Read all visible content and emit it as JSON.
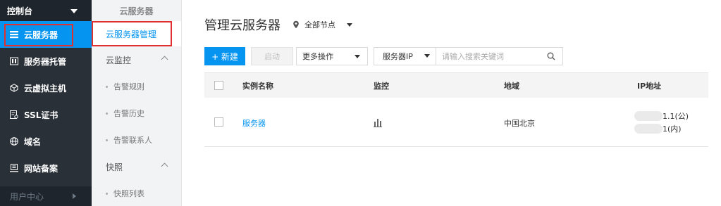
{
  "sidebar": {
    "header": "控制台",
    "items": [
      {
        "label": "云服务器",
        "icon": "server-list-icon"
      },
      {
        "label": "服务器托管",
        "icon": "hosting-icon"
      },
      {
        "label": "云虚拟主机",
        "icon": "cube-icon"
      },
      {
        "label": "SSL证书",
        "icon": "certificate-icon"
      },
      {
        "label": "域名",
        "icon": "globe-icon"
      },
      {
        "label": "网站备案",
        "icon": "record-icon"
      }
    ],
    "bottom": "用户中心"
  },
  "subnav": {
    "title": "云服务器",
    "active_link": "云服务器管理",
    "groups": [
      {
        "label": "云监控",
        "children": [
          "告警规则",
          "告警历史",
          "告警联系人"
        ]
      },
      {
        "label": "快照",
        "children": [
          "快照列表"
        ]
      }
    ]
  },
  "main": {
    "title": "管理云服务器",
    "region": "全部节点",
    "toolbar": {
      "new": "+ 新建",
      "start": "启动",
      "more": "更多操作",
      "search_field": "服务器IP",
      "search_placeholder": "请输入搜索关键词"
    },
    "table": {
      "columns": [
        "实例名称",
        "监控",
        "地域",
        "IP地址"
      ],
      "rows": [
        {
          "name": "服务器",
          "monitor_icon": "bar-chart-icon",
          "region": "中国北京",
          "ip_public": "1.1(公)",
          "ip_private": "1(内)"
        }
      ]
    }
  },
  "colors": {
    "accent": "#0594ef",
    "sidebar_bg": "#293038",
    "highlight_border": "#e03131"
  }
}
